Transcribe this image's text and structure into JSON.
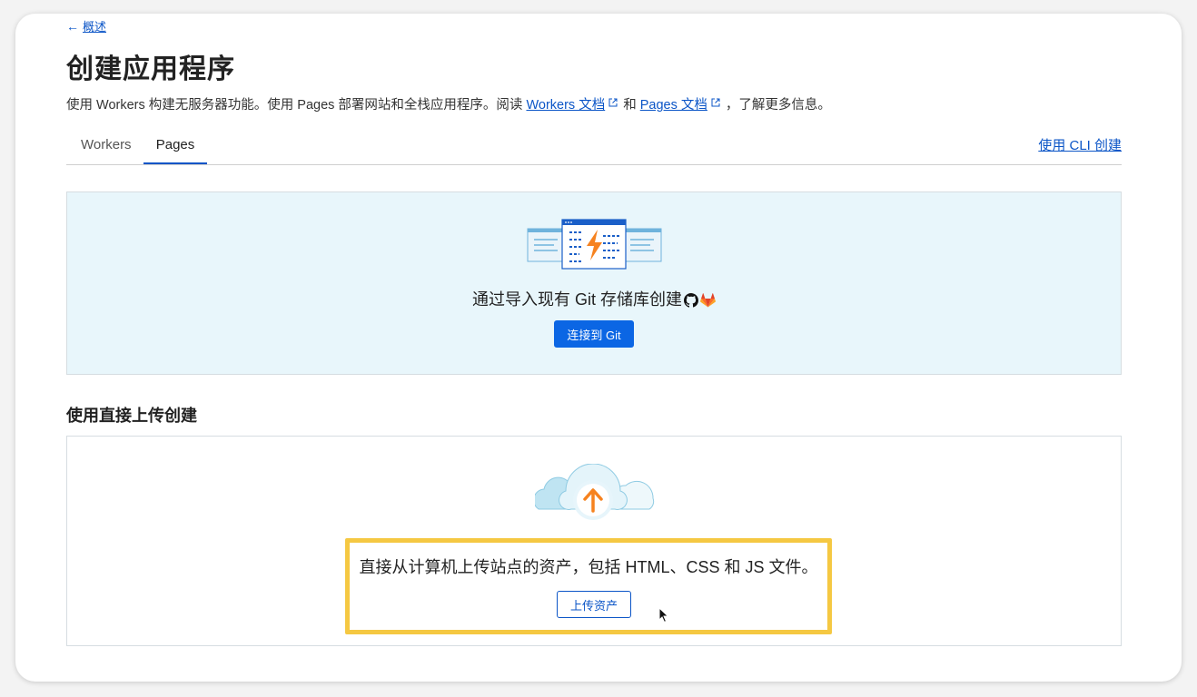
{
  "back": {
    "label": "概述"
  },
  "page": {
    "title": "创建应用程序",
    "description_prefix": "使用 Workers 构建无服务器功能。使用 Pages 部署网站和全栈应用程序。阅读 ",
    "workers_doc_link": "Workers 文档",
    "middle": "和 ",
    "pages_doc_link": "Pages 文档",
    "suffix": "，了解更多信息。"
  },
  "tabs": [
    {
      "label": "Workers",
      "active": false
    },
    {
      "label": "Pages",
      "active": true
    }
  ],
  "cli_link": "使用 CLI 创建",
  "git": {
    "text": "通过导入现有 Git 存储库创建",
    "button": "连接到 Git"
  },
  "direct_upload": {
    "section_title": "使用直接上传创建",
    "text": "直接从计算机上传站点的资产，包括 HTML、CSS 和 JS 文件。",
    "button": "上传资产"
  },
  "icons": [
    "back-arrow-icon",
    "external-link-icon",
    "github-icon",
    "gitlab-icon",
    "upload-cloud-icon",
    "mouse-cursor-icon"
  ],
  "colors": {
    "accent": "#0b66e4",
    "highlight": "#f5c842",
    "git_card_bg": "#e8f6fb"
  }
}
